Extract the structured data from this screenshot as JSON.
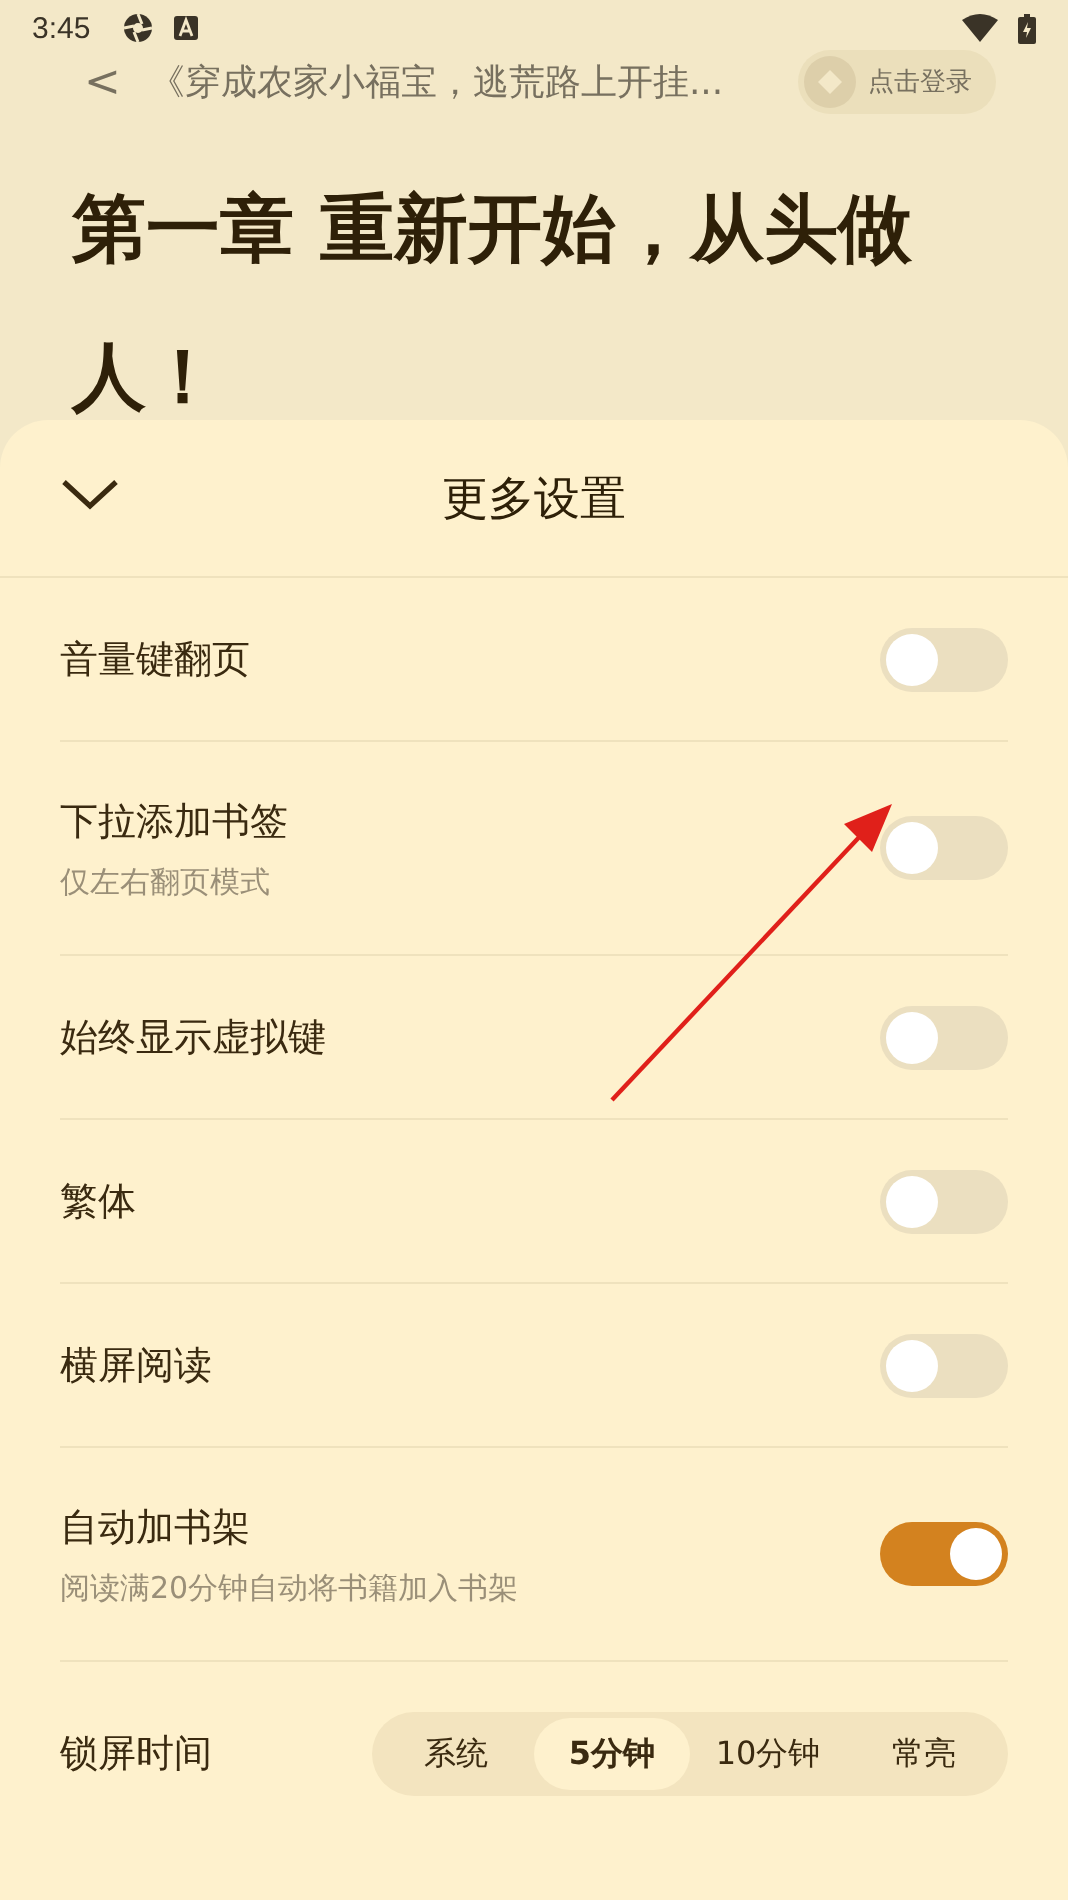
{
  "status_bar": {
    "time": "3:45"
  },
  "header": {
    "back": "<",
    "book_title": "《穿成农家小福宝，逃荒路上开挂...",
    "login": "点击登录"
  },
  "chapter_title": "第一章 重新开始，从头做人！",
  "sheet": {
    "title": "更多设置",
    "settings": [
      {
        "kind": "toggle",
        "label": "音量键翻页",
        "on": false
      },
      {
        "kind": "toggle",
        "label": "下拉添加书签",
        "hint": "仅左右翻页模式",
        "on": false
      },
      {
        "kind": "toggle",
        "label": "始终显示虚拟键",
        "on": false
      },
      {
        "kind": "toggle",
        "label": "繁体",
        "on": false
      },
      {
        "kind": "toggle",
        "label": "横屏阅读",
        "on": false
      },
      {
        "kind": "toggle",
        "label": "自动加书架",
        "hint": "阅读满20分钟自动将书籍加入书架",
        "on": true
      },
      {
        "kind": "segments",
        "label": "锁屏时间",
        "options": [
          {
            "label": "系统",
            "selected": false
          },
          {
            "label": "5分钟",
            "selected": true
          },
          {
            "label": "10分钟",
            "selected": false
          },
          {
            "label": "常亮",
            "selected": false
          }
        ]
      }
    ]
  }
}
